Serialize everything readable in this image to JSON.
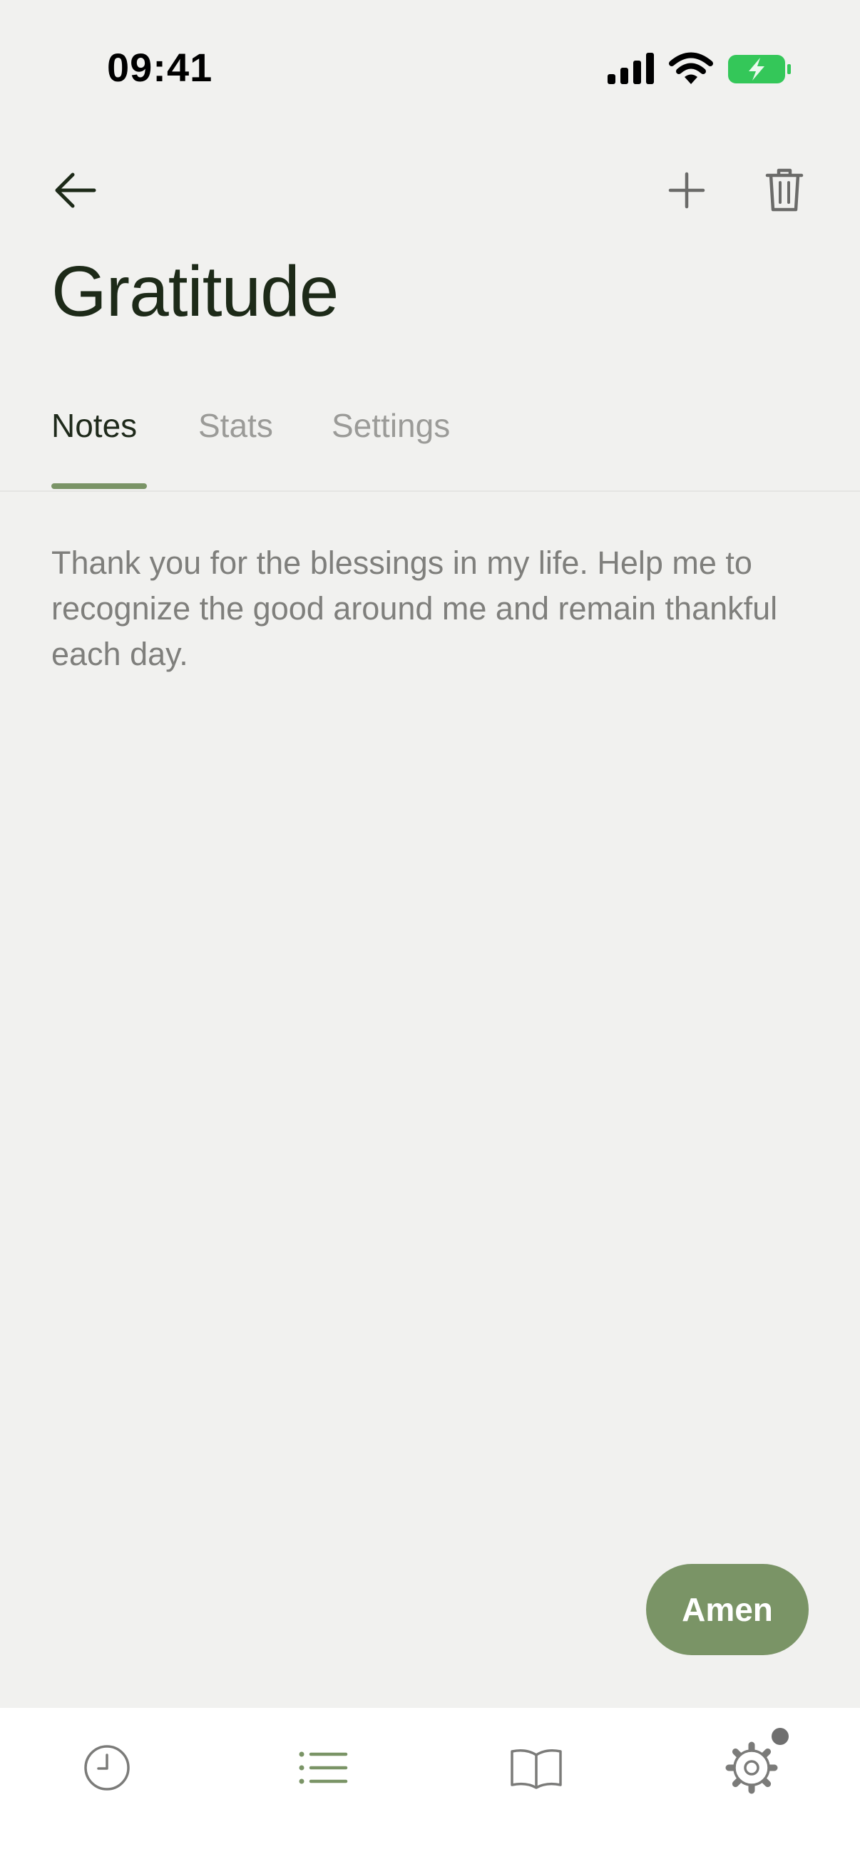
{
  "status_bar": {
    "time": "09:41"
  },
  "header": {
    "title": "Gratitude"
  },
  "tabs": [
    {
      "label": "Notes",
      "active": true
    },
    {
      "label": "Stats",
      "active": false
    },
    {
      "label": "Settings",
      "active": false
    }
  ],
  "note": {
    "text": "Thank you for the blessings in my life. Help me to recognize the good around me and remain thankful each day."
  },
  "action": {
    "amen_label": "Amen"
  },
  "colors": {
    "accent": "#7a9466",
    "background": "#f1f1ef",
    "title": "#1d2a18",
    "muted": "#9b9b98"
  },
  "icons": {
    "back": "arrow-left-icon",
    "add": "plus-icon",
    "delete": "trash-icon",
    "nav": [
      "clock-icon",
      "list-icon",
      "book-icon",
      "gear-icon"
    ]
  }
}
